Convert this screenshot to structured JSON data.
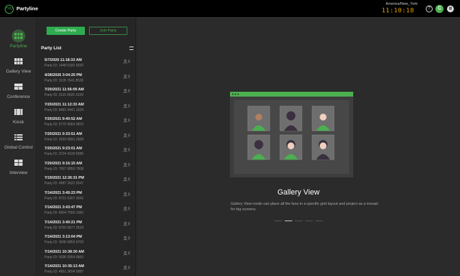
{
  "header": {
    "app_title": "Partyline",
    "logo_text": "TVU",
    "timezone": "America/New_York",
    "clock": "11:10:18",
    "help_label": "?",
    "avatar_initial": "C",
    "grid_label": "⊞"
  },
  "sidebar": {
    "items": [
      {
        "label": "Partyline",
        "icon": "partyline-icon",
        "active": true
      },
      {
        "label": "Gallery View",
        "icon": "gallery-view-icon",
        "active": false
      },
      {
        "label": "Conference",
        "icon": "conference-icon",
        "active": false
      },
      {
        "label": "Kiosk",
        "icon": "kiosk-icon",
        "active": false
      },
      {
        "label": "Global Control",
        "icon": "global-control-icon",
        "active": false
      },
      {
        "label": "Interview",
        "icon": "interview-icon",
        "active": false
      }
    ]
  },
  "panel": {
    "create_label": "Create Party",
    "join_label": "Join Party",
    "list_title": "Party List",
    "parties": [
      {
        "date": "5/7/2026 11:18:33 AM",
        "id": "Party ID: 1448 0182 6030",
        "count": "0"
      },
      {
        "date": "4/28/2026 3:04:25 PM",
        "id": "Party ID: 1105 7641 8538",
        "count": "0"
      },
      {
        "date": "7/20/2021 11:56:09 AM",
        "id": "Party ID: 3115 6626 3199",
        "count": "0"
      },
      {
        "date": "7/20/2021 11:12:33 AM",
        "id": "Party ID: 8481 6441 1039",
        "count": "0"
      },
      {
        "date": "7/20/2021 9:40:52 AM",
        "id": "Party ID: 5770 9064 9870",
        "count": "0"
      },
      {
        "date": "7/20/2021 9:33:51 AM",
        "id": "Party ID: 2633 6891 2668",
        "count": "0"
      },
      {
        "date": "7/20/2021 9:23:01 AM",
        "id": "Party ID: 3724 4100 6586",
        "count": "0"
      },
      {
        "date": "7/20/2021 9:16:15 AM",
        "id": "Party ID: 7007 8859 7908",
        "count": "0"
      },
      {
        "date": "7/19/2021 12:26:31 PM",
        "id": "Party ID: 4987 2622 5547",
        "count": "0"
      },
      {
        "date": "7/14/2021 3:45:23 PM",
        "id": "Party ID: 9721 6307 3042",
        "count": "0"
      },
      {
        "date": "7/14/2021 3:43:47 PM",
        "id": "Party ID: 4504 7556 1082",
        "count": "0"
      },
      {
        "date": "7/14/2021 3:40:21 PM",
        "id": "Party ID: 8759 5877 3518",
        "count": "0"
      },
      {
        "date": "7/14/2021 3:13:04 PM",
        "id": "Party ID: 3046 6853 9709",
        "count": "0"
      },
      {
        "date": "7/14/2021 10:38:30 AM",
        "id": "Party ID: 5036 0054 9665",
        "count": "0"
      },
      {
        "date": "7/14/2021 10:35:13 AM",
        "id": "Party ID: 4651 3694 0087",
        "count": "0"
      }
    ]
  },
  "main": {
    "title": "Gallery View",
    "description": "Gallery View mode can place all the fans in a specific grid layout and project as a mosaic for big screens.",
    "carousel_active_index": 1,
    "carousel_count": 5,
    "colors": {
      "accent": "#4caf50",
      "frame": "#4f4f4f",
      "tile": "#6e6e6e"
    }
  }
}
